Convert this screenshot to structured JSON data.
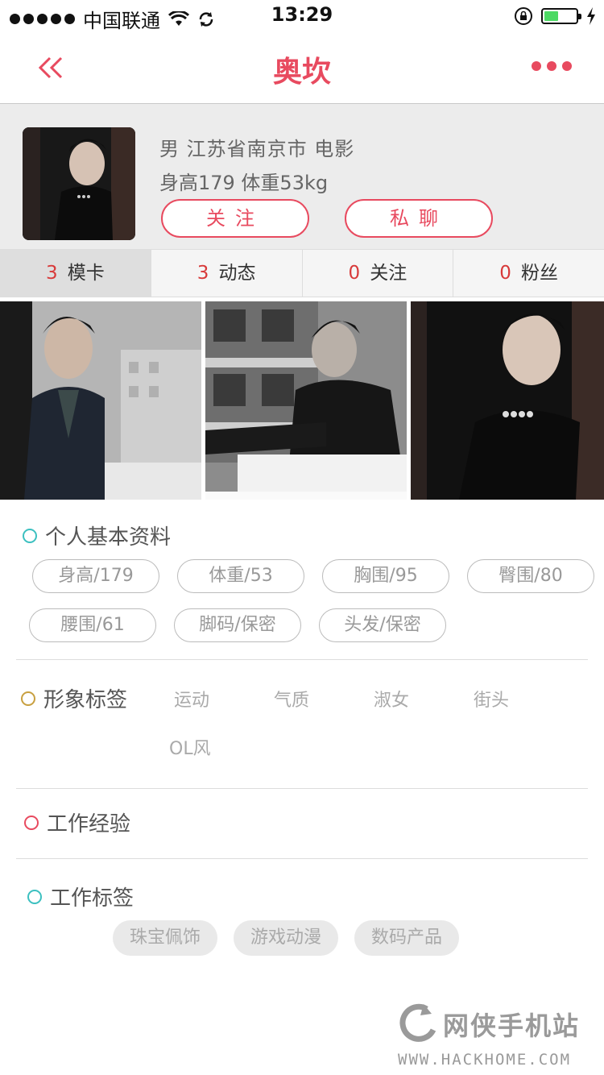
{
  "status_bar": {
    "carrier": "中国联通",
    "time": "13:29",
    "battery_level": 0.45,
    "battery_color": "#4cd964"
  },
  "nav": {
    "title": "奥坎",
    "back_icon": "double-chevron-left-icon",
    "more_icon": "more-dots-icon",
    "accent": "#e84a5f"
  },
  "profile": {
    "info_line1": "男 江苏省南京市  电影",
    "info_line2": "身高179  体重53kg",
    "follow_label": "关注",
    "chat_label": "私聊"
  },
  "tabs": [
    {
      "count": "3",
      "label": "模卡"
    },
    {
      "count": "3",
      "label": "动态"
    },
    {
      "count": "0",
      "label": "关注"
    },
    {
      "count": "0",
      "label": "粉丝"
    }
  ],
  "basic_info": {
    "title": "个人基本资料",
    "ring_color": "#3cc0c0",
    "pills": [
      "身高/179",
      "体重/53",
      "胸围/95",
      "臀围/80",
      "腰围/61",
      "脚码/保密",
      "头发/保密"
    ]
  },
  "image_tags": {
    "title": "形象标签",
    "ring_color": "#c8a040",
    "tags": [
      "运动",
      "气质",
      "淑女",
      "街头",
      "OL风"
    ]
  },
  "work_experience": {
    "title": "工作经验",
    "ring_color": "#e84a5f"
  },
  "work_tags": {
    "title": "工作标签",
    "ring_color": "#3cc0c0",
    "tags": [
      "珠宝佩饰",
      "游戏动漫",
      "数码产品"
    ]
  },
  "watermark": {
    "name": "网侠手机站",
    "url": "WWW.HACKHOME.COM"
  }
}
